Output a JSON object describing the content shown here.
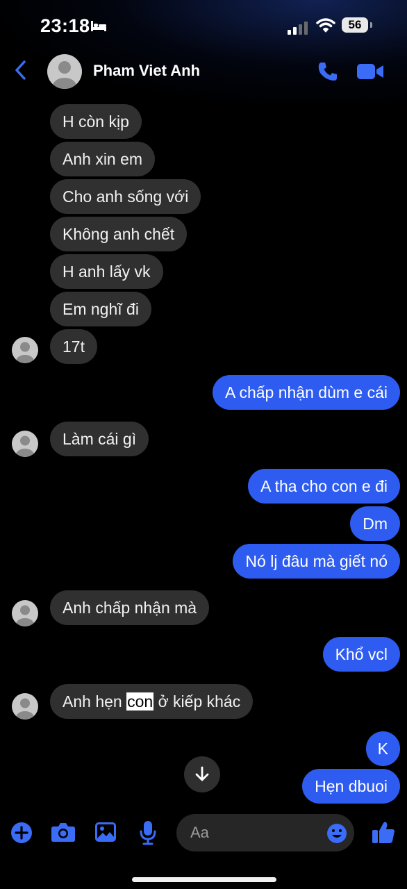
{
  "status_bar": {
    "time": "23:18",
    "battery": "56"
  },
  "header": {
    "contact_name": "Pham Viet Anh"
  },
  "messages": [
    {
      "side": "in",
      "text": "H còn kịp"
    },
    {
      "side": "in",
      "text": "Anh xin em"
    },
    {
      "side": "in",
      "text": "Cho anh sống với"
    },
    {
      "side": "in",
      "text": "Không anh chết"
    },
    {
      "side": "in",
      "text": "H anh lấy vk"
    },
    {
      "side": "in",
      "text": "Em nghĩ đi"
    },
    {
      "side": "in",
      "text": "17t"
    },
    {
      "side": "out",
      "text": "A chấp nhận dùm e cái"
    },
    {
      "side": "in",
      "text": "Làm cái gì"
    },
    {
      "side": "out",
      "text": "A tha cho con e đi"
    },
    {
      "side": "out",
      "text": "Dm"
    },
    {
      "side": "out",
      "text": "Nó lj đâu mà giết nó"
    },
    {
      "side": "in",
      "text": "Anh chấp nhận mà"
    },
    {
      "side": "out",
      "text": "Khổ vcl"
    },
    {
      "side": "in",
      "text_before": "Anh hẹn ",
      "text_highlight": "con",
      "text_after": " ở kiếp khác"
    },
    {
      "side": "out",
      "text": "K"
    },
    {
      "side": "out",
      "text": "Hẹn dbuoi"
    }
  ],
  "composer": {
    "placeholder": "Aa"
  },
  "colors": {
    "accent": "#2e5cf0",
    "incoming_bubble": "#303030",
    "icon_blue": "#3b6cf5"
  },
  "icons": {
    "back": "chevron-left-icon",
    "call": "phone-icon",
    "video": "video-camera-icon",
    "scroll": "arrow-down-icon",
    "add": "plus-circle-icon",
    "camera": "camera-icon",
    "gallery": "image-icon",
    "voice": "microphone-icon",
    "emoji": "smiley-icon",
    "like": "thumbs-up-icon"
  }
}
